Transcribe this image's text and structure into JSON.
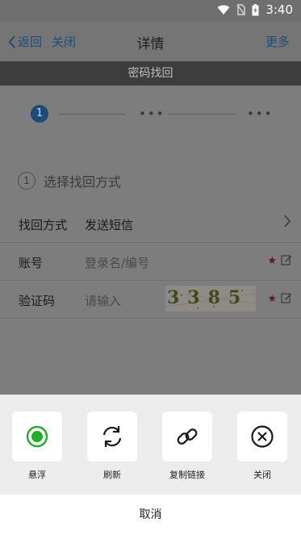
{
  "status_bar": {
    "time": "3:40",
    "icons": [
      "wifi-icon",
      "no-sim-icon",
      "battery-charging-icon"
    ]
  },
  "nav": {
    "back_label": "返回",
    "close_label": "关闭",
    "title": "详情",
    "more_label": "更多"
  },
  "section_header": "密码找回",
  "steps": {
    "current": "1",
    "dots": "•••"
  },
  "method": {
    "number": "1",
    "title": "选择找回方式"
  },
  "form": {
    "recovery_method": {
      "label": "找回方式",
      "value": "发送短信"
    },
    "account": {
      "label": "账号",
      "placeholder": "登录名/编号"
    },
    "captcha": {
      "label": "验证码",
      "placeholder": "请输入",
      "code": "3385"
    },
    "required_mark": "★"
  },
  "sheet": {
    "actions": [
      {
        "label": "悬浮",
        "icon": "radio-selected-icon"
      },
      {
        "label": "刷新",
        "icon": "refresh-icon"
      },
      {
        "label": "复制链接",
        "icon": "link-icon"
      },
      {
        "label": "关闭",
        "icon": "close-circle-icon"
      }
    ],
    "cancel_label": "取消"
  },
  "colors": {
    "accent_green": "#1fae25",
    "nav_link": "#1f4c7a"
  }
}
